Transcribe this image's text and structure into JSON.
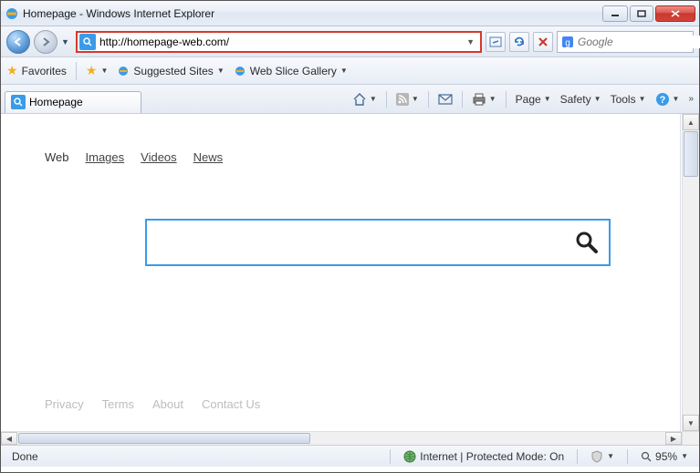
{
  "window": {
    "title": "Homepage - Windows Internet Explorer"
  },
  "address": {
    "url": "http://homepage-web.com/"
  },
  "search_provider": {
    "placeholder": "Google"
  },
  "favorites_bar": {
    "favorites_label": "Favorites",
    "suggested_label": "Suggested Sites",
    "webslice_label": "Web Slice Gallery"
  },
  "tab": {
    "title": "Homepage"
  },
  "command_bar": {
    "page": "Page",
    "safety": "Safety",
    "tools": "Tools"
  },
  "page": {
    "nav": {
      "web": "Web",
      "images": "Images",
      "videos": "Videos",
      "news": "News"
    },
    "search_value": "",
    "footer": {
      "privacy": "Privacy",
      "terms": "Terms",
      "about": "About",
      "contact": "Contact Us"
    }
  },
  "status": {
    "left": "Done",
    "zone": "Internet | Protected Mode: On",
    "zoom": "95%"
  }
}
